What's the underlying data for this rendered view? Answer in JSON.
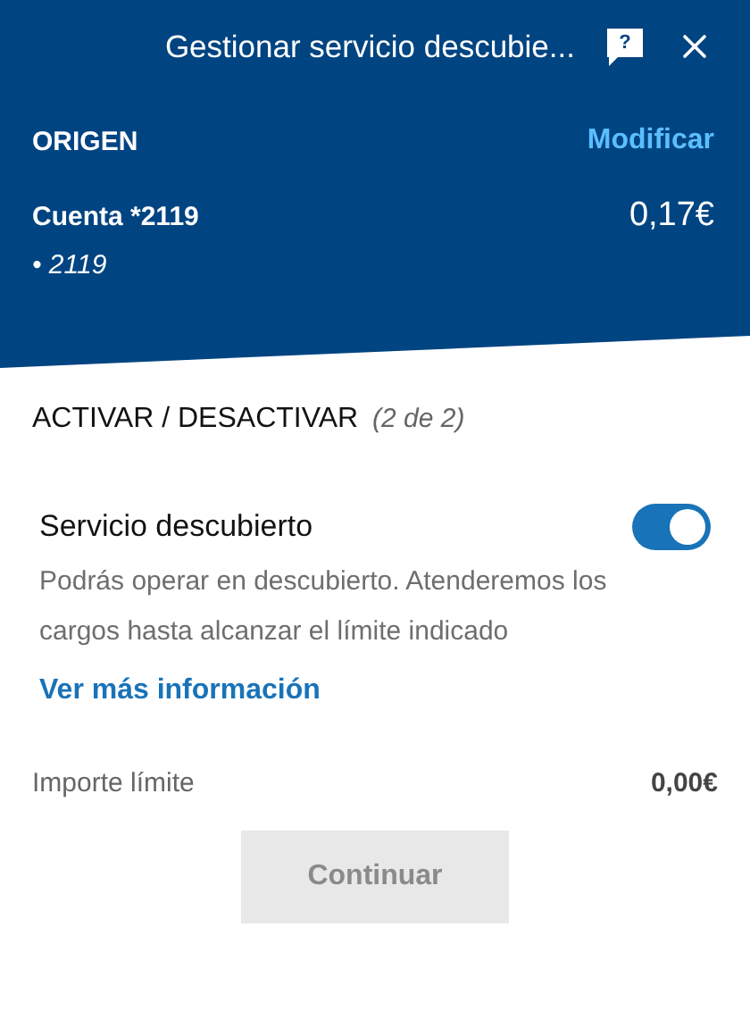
{
  "header": {
    "title": "Gestionar servicio descubie...",
    "help_glyph": "?"
  },
  "origin": {
    "label": "ORIGEN",
    "action": "Modificar",
    "account": "Cuenta *2119",
    "balance": "0,17€",
    "detail": "• 2119"
  },
  "section": {
    "title": "ACTIVAR / DESACTIVAR",
    "step": "(2 de 2)"
  },
  "service": {
    "name": "Servicio descubierto",
    "on": true,
    "description": "Podrás operar en descubierto. Atenderemos los cargos hasta alcanzar el límite indicado",
    "link": "Ver más información"
  },
  "limit": {
    "label": "Importe límite",
    "value": "0,00€"
  },
  "continue_button": {
    "label": "Continuar",
    "disabled": true
  }
}
